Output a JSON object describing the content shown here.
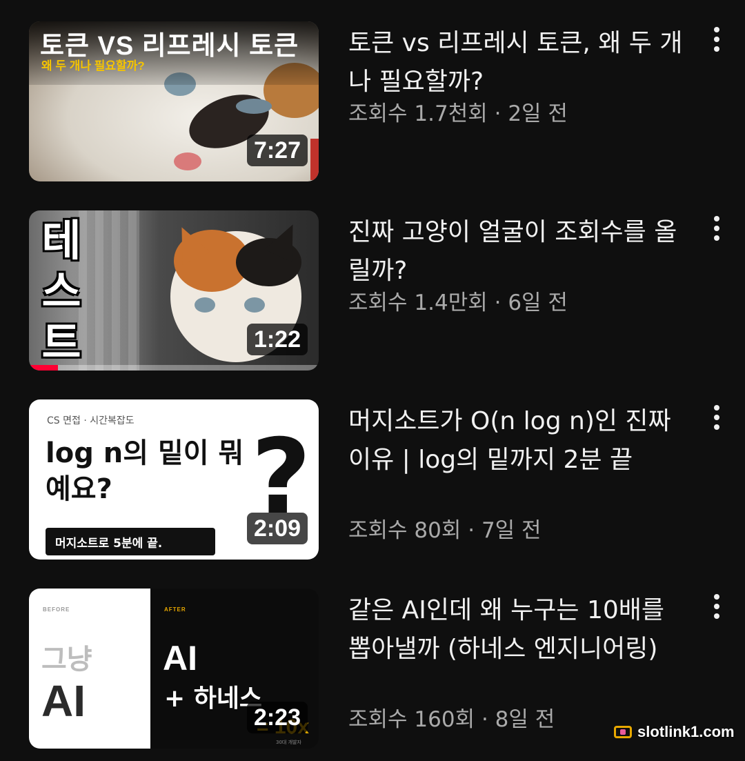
{
  "videos": [
    {
      "title": "토큰 vs 리프레시 토큰, 왜 두 개나 필요할까?",
      "meta": "조회수 1.7천회 · 2일 전",
      "duration": "7:27",
      "thumbnail": {
        "headline": "토큰 VS 리프레시 토큰",
        "subline": "왜 두 개나 필요할까?"
      }
    },
    {
      "title": "진짜 고양이 얼굴이 조회수를 올릴까?",
      "meta": "조회수 1.4만회 · 6일 전",
      "duration": "1:22",
      "watch_progress_percent": 10,
      "thumbnail": {
        "vertical_text": "테스트"
      }
    },
    {
      "title": "머지소트가 O(n log n)인 진짜 이유 | log의 밑까지 2분 끝",
      "meta": "조회수 80회 · 7일 전",
      "duration": "2:09",
      "thumbnail": {
        "caption": "CS 면접 · 시간복잡도",
        "big_text": "log n의 밑이 뭐예요?",
        "question_mark": "?",
        "box_text": "머지소트로 5분에 끝."
      }
    },
    {
      "title": "같은 AI인데 왜 누구는 10배를 뽑아낼까 (하네스 엔지니어링)",
      "meta": "조회수 160회 · 8일 전",
      "duration": "2:23",
      "thumbnail": {
        "before_label": "BEFORE",
        "after_label": "AFTER",
        "plain_word": "그냥",
        "ai_left": "AI",
        "ai_right": "AI",
        "plus_text": "+ 하네스",
        "tenx": "= 10x",
        "dev_label": "30대 개발자"
      }
    }
  ],
  "more_icon": "vertical-ellipsis-icon",
  "watermark": {
    "text": "slotlink1.com"
  },
  "colors": {
    "background": "#0f0f0f",
    "title": "#f1f1f1",
    "meta": "#aaaaaa",
    "progress": "#ff0033"
  }
}
